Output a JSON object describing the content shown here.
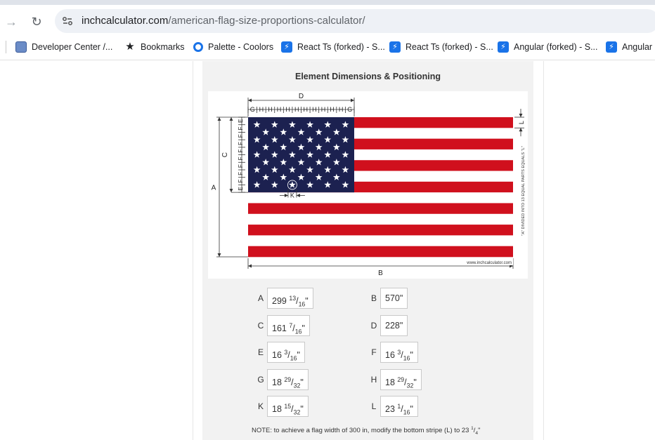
{
  "browser": {
    "url_host": "inchcalculator.com",
    "url_path": "/american-flag-size-proportions-calculator/",
    "bookmarks": [
      {
        "label": "Developer Center /...",
        "icon": "developer-center-icon"
      },
      {
        "label": "Bookmarks",
        "icon": "star-icon"
      },
      {
        "label": "Palette - Coolors",
        "icon": "coolors-icon"
      },
      {
        "label": "React Ts (forked) - S...",
        "icon": "stackblitz-icon"
      },
      {
        "label": "React Ts (forked) - S...",
        "icon": "stackblitz-icon"
      },
      {
        "label": "Angular (forked) - S...",
        "icon": "stackblitz-icon"
      },
      {
        "label": "Angular (",
        "icon": "stackblitz-icon"
      }
    ]
  },
  "section": {
    "title": "Element Dimensions & Positioning"
  },
  "diagram": {
    "labels": {
      "A": "A",
      "B": "B",
      "C": "C",
      "D": "D",
      "K": "K",
      "L": "L",
      "E": "E",
      "F": "F",
      "G": "G",
      "H": "H"
    },
    "side_note": "\"A\" DIVIDED INTO 13 EQUAL PARTS EQUALS \"L\"",
    "watermark": "www.inchcalculator.com",
    "colors": {
      "red": "#d0101d",
      "blue": "#1c2150",
      "white": "#ffffff"
    }
  },
  "results": {
    "A": {
      "label": "A",
      "whole": "299",
      "num": "13",
      "den": "16",
      "unit": "\""
    },
    "B": {
      "label": "B",
      "whole": "570",
      "num": "",
      "den": "",
      "unit": "\""
    },
    "C": {
      "label": "C",
      "whole": "161",
      "num": "7",
      "den": "16",
      "unit": "\""
    },
    "D": {
      "label": "D",
      "whole": "228",
      "num": "",
      "den": "",
      "unit": "\""
    },
    "E": {
      "label": "E",
      "whole": "16",
      "num": "3",
      "den": "16",
      "unit": "\""
    },
    "F": {
      "label": "F",
      "whole": "16",
      "num": "3",
      "den": "16",
      "unit": "\""
    },
    "G": {
      "label": "G",
      "whole": "18",
      "num": "29",
      "den": "32",
      "unit": "\""
    },
    "H": {
      "label": "H",
      "whole": "18",
      "num": "29",
      "den": "32",
      "unit": "\""
    },
    "K": {
      "label": "K",
      "whole": "18",
      "num": "15",
      "den": "32",
      "unit": "\""
    },
    "L": {
      "label": "L",
      "whole": "23",
      "num": "1",
      "den": "16",
      "unit": "\""
    }
  },
  "note": {
    "prefix": "NOTE: to achieve a flag width of 300 in, modify the bottom stripe (L) to 23 ",
    "num": "1",
    "den": "4",
    "suffix": "\""
  }
}
